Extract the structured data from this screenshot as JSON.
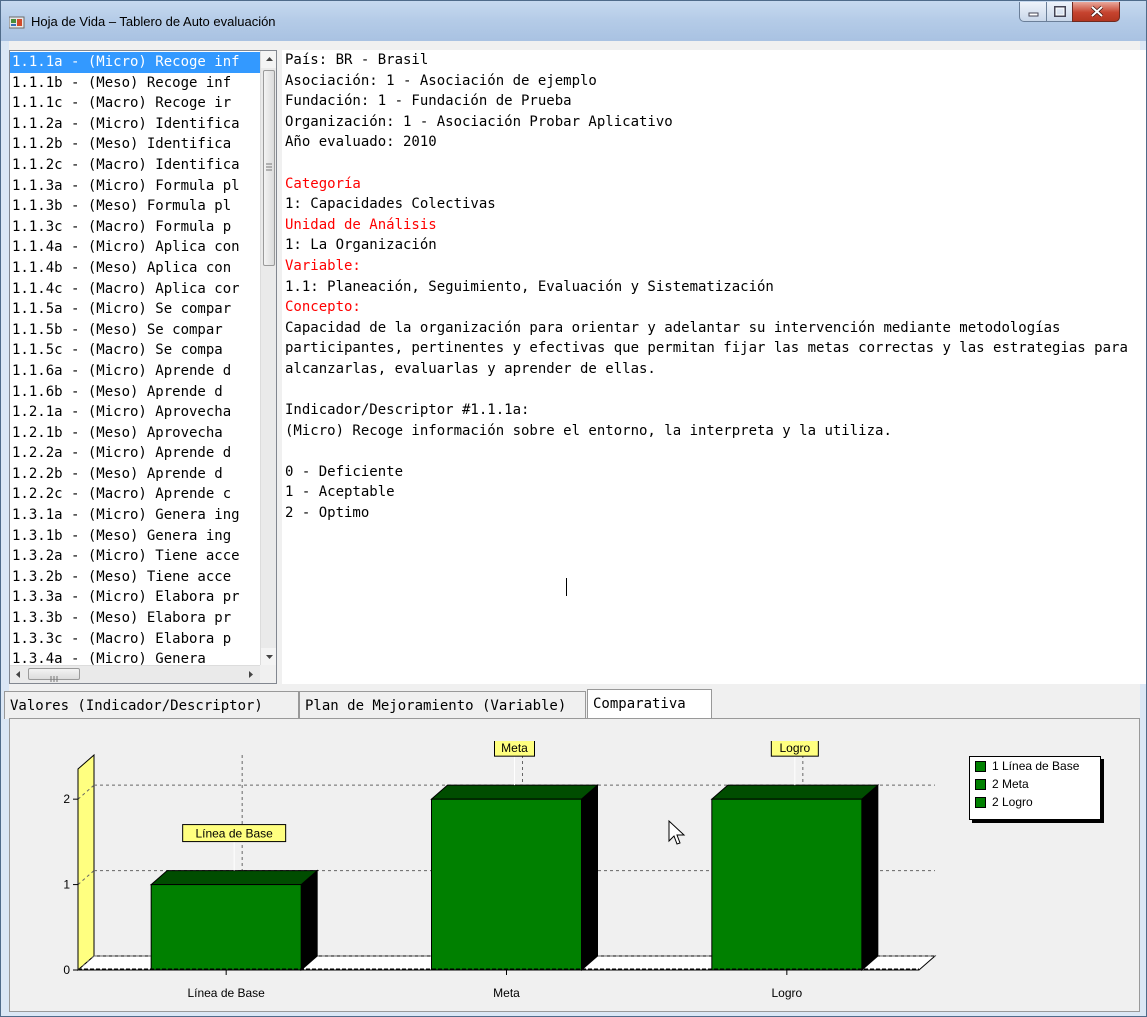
{
  "window": {
    "title": "Hoja de Vida – Tablero de Auto evaluación"
  },
  "indicator_list": {
    "selected_index": 0,
    "items": [
      "1.1.1a - (Micro) Recoge inf",
      "1.1.1b - (Meso) Recoge inf",
      "1.1.1c - (Macro) Recoge ir",
      "1.1.2a - (Micro) Identifica",
      "1.1.2b - (Meso) Identifica",
      "1.1.2c - (Macro) Identifica",
      "1.1.3a - (Micro) Formula pl",
      "1.1.3b - (Meso) Formula pl",
      "1.1.3c - (Macro) Formula p",
      "1.1.4a - (Micro) Aplica con",
      "1.1.4b - (Meso) Aplica con",
      "1.1.4c - (Macro) Aplica cor",
      "1.1.5a - (Micro) Se compar",
      "1.1.5b - (Meso) Se compar",
      "1.1.5c - (Macro) Se compa",
      "1.1.6a - (Micro) Aprende d",
      "1.1.6b - (Meso) Aprende d",
      "1.2.1a - (Micro) Aprovecha",
      "1.2.1b - (Meso) Aprovecha",
      "1.2.2a - (Micro) Aprende d",
      "1.2.2b - (Meso) Aprende d",
      "1.2.2c - (Macro) Aprende c",
      "1.3.1a - (Micro) Genera ing",
      "1.3.1b - (Meso) Genera ing",
      "1.3.2a - (Micro) Tiene acce",
      "1.3.2b - (Meso) Tiene acce",
      "1.3.3a - (Micro) Elabora pr",
      "1.3.3b - (Meso) Elabora pr",
      "1.3.3c - (Macro) Elabora p",
      "1.3.4a - (Micro) Genera"
    ]
  },
  "details": {
    "lines": [
      {
        "text": "País: BR - Brasil",
        "red": false
      },
      {
        "text": "Asociación: 1 - Asociación de ejemplo",
        "red": false
      },
      {
        "text": "Fundación: 1 - Fundación de Prueba",
        "red": false
      },
      {
        "text": "Organización: 1 - Asociación Probar Aplicativo",
        "red": false
      },
      {
        "text": "Año evaluado: 2010",
        "red": false
      },
      {
        "text": "",
        "red": false
      },
      {
        "text": "Categoría",
        "red": true
      },
      {
        "text": "1: Capacidades Colectivas",
        "red": false
      },
      {
        "text": "Unidad de Análisis",
        "red": true
      },
      {
        "text": "1: La Organización",
        "red": false
      },
      {
        "text": "Variable:",
        "red": true
      },
      {
        "text": "1.1: Planeación, Seguimiento, Evaluación y Sistematización",
        "red": false
      },
      {
        "text": "Concepto:",
        "red": true
      },
      {
        "text": "Capacidad de la organización para orientar y adelantar su intervención mediante metodologías",
        "red": false
      },
      {
        "text": "participantes, pertinentes y efectivas que permitan fijar las metas correctas y las estrategias para",
        "red": false
      },
      {
        "text": "alcanzarlas, evaluarlas y aprender de ellas.",
        "red": false
      },
      {
        "text": "",
        "red": false
      },
      {
        "text": "Indicador/Descriptor #1.1.1a:",
        "red": false
      },
      {
        "text": "(Micro) Recoge información sobre el entorno, la interpreta y la utiliza.",
        "red": false
      },
      {
        "text": "",
        "red": false
      },
      {
        "text": "0 - Deficiente",
        "red": false
      },
      {
        "text": "1 - Aceptable",
        "red": false
      },
      {
        "text": "2 - Optimo",
        "red": false
      }
    ]
  },
  "tabs": [
    {
      "label": "Valores (Indicador/Descriptor)",
      "active": false
    },
    {
      "label": "Plan de Mejoramiento (Variable)",
      "active": false
    },
    {
      "label": "Comparativa",
      "active": true
    }
  ],
  "colors": {
    "bar": "#008000",
    "bar_top": "#004d00",
    "bar_side": "#000000",
    "wall": "#ffff80",
    "mark_bg": "#ffff80",
    "selection": "#3399ff",
    "section_heading": "#ff0000"
  },
  "chart_data": {
    "type": "bar",
    "categories": [
      "Línea de Base",
      "Meta",
      "Logro"
    ],
    "values": [
      1,
      2,
      2
    ],
    "marks": [
      "Línea de Base",
      "Meta",
      "Logro"
    ],
    "yticks": [
      0,
      1,
      2
    ],
    "ylim": [
      0,
      2.4
    ],
    "grid": true,
    "legend": {
      "position": "top-right",
      "entries": [
        "1 Línea de Base",
        "2 Meta",
        "2 Logro"
      ]
    }
  }
}
